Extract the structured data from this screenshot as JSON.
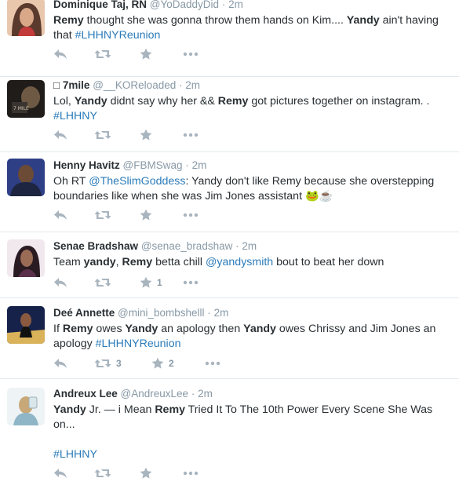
{
  "tweets": [
    {
      "fullname": "Dominique Taj, RN",
      "username": "@YoDaddyDid",
      "dot": "·",
      "time": "2m",
      "segments": [
        {
          "b": "Remy"
        },
        {
          "t": " thought she was gonna throw them hands on Kim.... "
        },
        {
          "b": "Yandy"
        },
        {
          "t": " ain't having that "
        },
        {
          "l": "#LHHNYReunion"
        }
      ],
      "retweets": "",
      "favorites": "",
      "avatar_colors": [
        "#d8a889",
        "#5a3a2c"
      ]
    },
    {
      "fullname": "□ 7mile",
      "username": "@__KOReloaded",
      "dot": "·",
      "time": "2m",
      "segments": [
        {
          "t": "Lol, "
        },
        {
          "b": "Yandy"
        },
        {
          "t": " didnt say why her && "
        },
        {
          "b": "Remy"
        },
        {
          "t": " got pictures together on instagram. . "
        },
        {
          "l": "#LHHNY"
        }
      ],
      "retweets": "",
      "favorites": "",
      "avatar_colors": [
        "#2c2a28",
        "#6e5a44"
      ]
    },
    {
      "fullname": "Henny Havitz",
      "username": "@FBMSwag",
      "dot": "·",
      "time": "2m",
      "segments": [
        {
          "t": "Oh RT "
        },
        {
          "l": "@TheSlimGoddess"
        },
        {
          "t": ": Yandy don't like Remy because she overstepping boundaries like when she was Jim Jones assistant 🐸☕"
        }
      ],
      "retweets": "",
      "favorites": "",
      "avatar_colors": [
        "#3a4fa0",
        "#6b4a36"
      ]
    },
    {
      "fullname": "Senae Bradshaw",
      "username": "@senae_bradshaw",
      "dot": "·",
      "time": "2m",
      "segments": [
        {
          "t": "Team "
        },
        {
          "b": "yandy"
        },
        {
          "t": ", "
        },
        {
          "b": "Remy"
        },
        {
          "t": " betta chill "
        },
        {
          "l": "@yandysmith"
        },
        {
          "t": " bout to beat her down"
        }
      ],
      "retweets": "",
      "favorites": "1",
      "avatar_colors": [
        "#e8dde3",
        "#3a2530"
      ]
    },
    {
      "fullname": "Deé Annette",
      "username": "@mini_bombshelll",
      "dot": "·",
      "time": "2m",
      "segments": [
        {
          "t": "If "
        },
        {
          "b": "Remy"
        },
        {
          "t": " owes "
        },
        {
          "b": "Yandy"
        },
        {
          "t": " an apology then "
        },
        {
          "b": "Yandy"
        },
        {
          "t": " owes Chrissy and Jim Jones an apology  "
        },
        {
          "l": "#LHHNYReunion"
        }
      ],
      "retweets": "3",
      "favorites": "2",
      "avatar_colors": [
        "#1c2b5a",
        "#c9a25a"
      ]
    },
    {
      "fullname": "Andreux Lee",
      "username": "@AndreuxLee",
      "dot": "·",
      "time": "2m",
      "segments": [
        {
          "b": "Yandy"
        },
        {
          "t": " Jr. — i Mean "
        },
        {
          "b": "Remy"
        },
        {
          "t": " Tried It To The 10th Power Every Scene She Was on...\n\n"
        },
        {
          "l": "#LHHNY"
        }
      ],
      "retweets": "",
      "favorites": "",
      "avatar_colors": [
        "#d9e6ea",
        "#c8a878"
      ]
    }
  ],
  "icons": {
    "reply": "reply-icon",
    "retweet": "retweet-icon",
    "favorite": "star-icon",
    "more": "more-dots-icon"
  },
  "colors": {
    "text": "#292f33",
    "muted": "#8899a6",
    "link": "#2b7bb9",
    "action_icon": "#a8b4be",
    "divider": "#e1e8ed"
  }
}
